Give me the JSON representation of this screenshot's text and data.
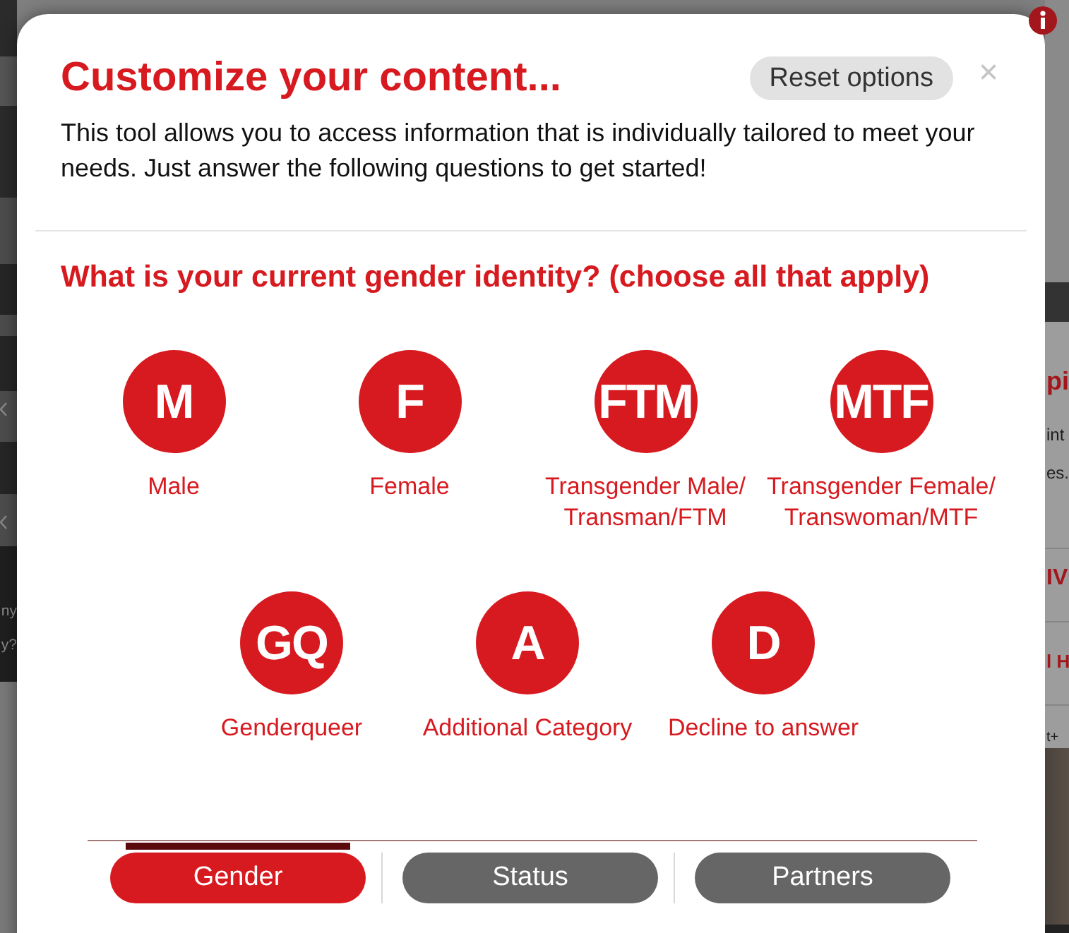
{
  "background_page": {
    "left_fragments": [
      "ny",
      "y?"
    ],
    "right_fragments": [
      {
        "kind": "heading",
        "text": "pi"
      },
      {
        "kind": "body",
        "text": "int"
      },
      {
        "kind": "body",
        "text": "es."
      },
      {
        "kind": "heading",
        "text": "IV"
      },
      {
        "kind": "heading",
        "text": "l H"
      },
      {
        "kind": "caption",
        "text": "t+"
      }
    ]
  },
  "dialog": {
    "title": "Customize your content...",
    "reset_button": "Reset options",
    "close_button": "×",
    "intro": "This tool allows you to access information that is individually tailored to meet your needs. Just answer the following questions to get started!",
    "question": "What is your current gender identity? (choose all that apply)",
    "options": [
      {
        "code": "M",
        "label": "Male",
        "selected": false
      },
      {
        "code": "F",
        "label": "Female",
        "selected": false
      },
      {
        "code": "FTM",
        "label": "Transgender Male/ Transman/FTM",
        "selected": false
      },
      {
        "code": "MTF",
        "label": "Transgender Female/ Transwoman/MTF",
        "selected": false
      },
      {
        "code": "GQ",
        "label": "Genderqueer",
        "selected": false
      },
      {
        "code": "A",
        "label": "Additional Category",
        "selected": false
      },
      {
        "code": "D",
        "label": "Decline to answer",
        "selected": false
      }
    ],
    "tabs": [
      {
        "label": "Gender",
        "selected": true
      },
      {
        "label": "Status",
        "selected": false
      },
      {
        "label": "Partners",
        "selected": false
      }
    ]
  }
}
